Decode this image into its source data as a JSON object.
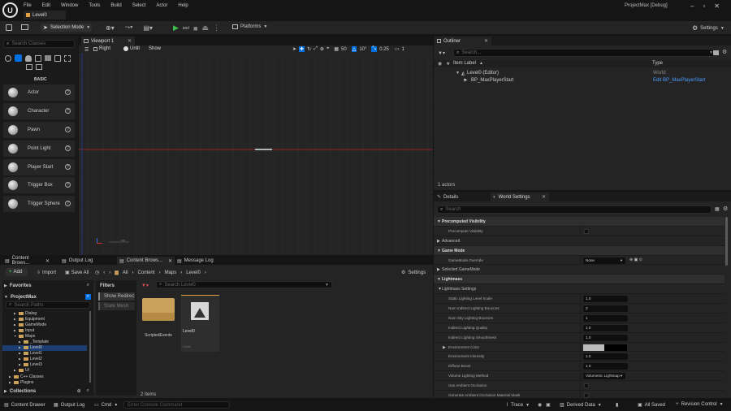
{
  "titlebar": {
    "menus": [
      "File",
      "Edit",
      "Window",
      "Tools",
      "Build",
      "Select",
      "Actor",
      "Help"
    ],
    "level_tab": "Level0",
    "project": "ProjectMax [Debug]"
  },
  "toolbar": {
    "mode": "Selection Mode",
    "platforms": "Platforms",
    "settings": "Settings"
  },
  "place": {
    "search_placeholder": "Search Classes",
    "category": "BASIC",
    "items": [
      "Actor",
      "Character",
      "Pawn",
      "Point Light",
      "Player Start",
      "Trigger Box",
      "Trigger Sphere"
    ]
  },
  "viewport": {
    "tab": "Viewport 1",
    "view": "Right",
    "lit": "Unlit",
    "show": "Show",
    "snap_grid": "50",
    "snap_rot": "10°",
    "snap_scale": "0.25",
    "cam_speed": "1"
  },
  "outliner": {
    "tab": "Outliner",
    "search_placeholder": "Search...",
    "col_label": "Item Label",
    "col_type": "Type",
    "rows": [
      {
        "label": "Level0 (Editor)",
        "type": "World"
      },
      {
        "label": "BP_MaxPlayerStart",
        "type": "Edit BP_MaxPlayerStart"
      }
    ],
    "count": "1 actors"
  },
  "details": {
    "tab": "Details",
    "world_tab": "World Settings",
    "search_placeholder": "Search",
    "rows": [
      {
        "kind": "cat",
        "label": "Precomputed Visibility"
      },
      {
        "kind": "prop",
        "label": "Precompute Visibility",
        "value": "",
        "ctrl": "check"
      },
      {
        "kind": "sub",
        "label": "Advanced"
      },
      {
        "kind": "cat",
        "label": "Game Mode"
      },
      {
        "kind": "prop",
        "label": "GameMode Override",
        "value": "None",
        "ctrl": "combo"
      },
      {
        "kind": "sub",
        "label": "Selected GameMode"
      },
      {
        "kind": "cat",
        "label": "Lightmass"
      },
      {
        "kind": "sub2",
        "label": "Lightmass Settings"
      },
      {
        "kind": "prop",
        "label": "Static Lighting Level Scale",
        "value": "1.0",
        "ctrl": "num"
      },
      {
        "kind": "prop",
        "label": "Num Indirect Lighting Bounces",
        "value": "3",
        "ctrl": "num"
      },
      {
        "kind": "prop",
        "label": "Num Sky Lighting Bounces",
        "value": "1",
        "ctrl": "num"
      },
      {
        "kind": "prop",
        "label": "Indirect Lighting Quality",
        "value": "1.0",
        "ctrl": "num"
      },
      {
        "kind": "prop",
        "label": "Indirect Lighting Smoothness",
        "value": "1.0",
        "ctrl": "num"
      },
      {
        "kind": "subprop",
        "label": "Environment Color",
        "value": "",
        "ctrl": "color"
      },
      {
        "kind": "prop",
        "label": "Environment Intensity",
        "value": "1.0",
        "ctrl": "num"
      },
      {
        "kind": "prop",
        "label": "Diffuse Boost",
        "value": "1.0",
        "ctrl": "num"
      },
      {
        "kind": "prop",
        "label": "Volume Lighting Method",
        "value": "Volumetric Lightmap",
        "ctrl": "combo"
      },
      {
        "kind": "prop",
        "label": "Use Ambient Occlusion",
        "value": "",
        "ctrl": "check"
      },
      {
        "kind": "prop",
        "label": "Generate Ambient Occlusion Material Mask",
        "value": "",
        "ctrl": "check"
      }
    ]
  },
  "bottom_tabs": [
    "Content Brows...",
    "Output Log",
    "Content Brows...",
    "Message Log"
  ],
  "content": {
    "add": "Add",
    "import": "Import",
    "save_all": "Save All",
    "crumbs": [
      "All",
      "Content",
      "Maps",
      "Level0"
    ],
    "settings": "Settings",
    "favorites": "Favorites",
    "project": "ProjectMax",
    "search_paths": "Search Paths",
    "filters": "Filters",
    "filter_items": [
      "Show Redirec",
      "State Mesh"
    ],
    "search_placeholder": "Search Level0",
    "assets": [
      {
        "name": "ScriptedEvents",
        "type": ""
      },
      {
        "name": "Level0",
        "type": "Level"
      }
    ],
    "count": "2 items",
    "collections": "Collections",
    "tree": [
      {
        "label": "Dialog",
        "indent": 1
      },
      {
        "label": "Equipment",
        "indent": 1
      },
      {
        "label": "GameMode",
        "indent": 1
      },
      {
        "label": "Input",
        "indent": 1
      },
      {
        "label": "Maps",
        "indent": 1
      },
      {
        "label": "_Template",
        "indent": 2
      },
      {
        "label": "Level0",
        "indent": 2,
        "selected": true
      },
      {
        "label": "Level1",
        "indent": 2
      },
      {
        "label": "Level2",
        "indent": 2
      },
      {
        "label": "Level3",
        "indent": 2
      },
      {
        "label": "UI",
        "indent": 1
      },
      {
        "label": "C++ Classes",
        "indent": 0
      },
      {
        "label": "Plugins",
        "indent": 0
      }
    ]
  },
  "status": {
    "drawer": "Content Drawer",
    "output": "Output Log",
    "cmd": "Cmd",
    "console_placeholder": "Enter Console Command",
    "trace": "Trace",
    "derived": "Derived Data",
    "saved": "All Saved",
    "revision": "Revision Control"
  },
  "colors": {
    "accent": "#0070e0",
    "folder": "#c9a15a",
    "play": "#3fbf4f"
  }
}
